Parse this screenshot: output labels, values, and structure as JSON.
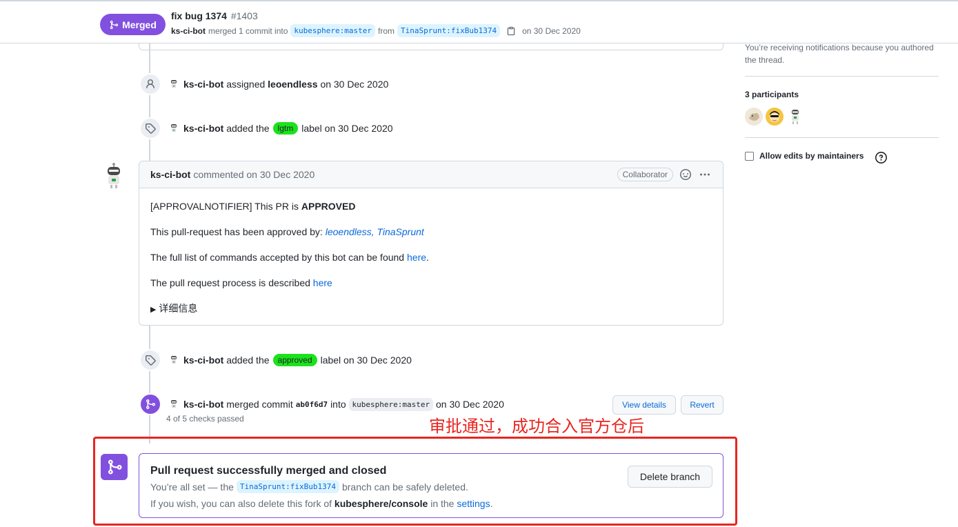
{
  "header": {
    "status": "Merged",
    "title": "fix bug 1374",
    "number": "#1403",
    "author": "ks-ci-bot",
    "merged_text": "merged 1 commit into",
    "base_branch": "kubesphere:master",
    "from_text": "from",
    "head_branch": "TinaSprunt:fixBub1374",
    "date": "on 30 Dec 2020"
  },
  "events": {
    "assigned": {
      "actor": "ks-ci-bot",
      "action": "assigned",
      "target": "leoendless",
      "date": "on 30 Dec 2020"
    },
    "label_lgtm": {
      "actor": "ks-ci-bot",
      "action": "added the",
      "label": "lgtm",
      "label_color": "#1ce21c",
      "suffix": "label on 30 Dec 2020"
    },
    "label_approved": {
      "actor": "ks-ci-bot",
      "action": "added the",
      "label": "approved",
      "label_color": "#1ce21c",
      "suffix": "label on 30 Dec 2020"
    },
    "merged": {
      "actor": "ks-ci-bot",
      "action": "merged commit",
      "sha": "ab0f6d7",
      "into": "into",
      "branch": "kubesphere:master",
      "date": "on 30 Dec 2020",
      "checks": "4 of 5 checks passed",
      "view_details": "View details",
      "revert": "Revert"
    }
  },
  "comment": {
    "author": "ks-ci-bot",
    "when": "commented on 30 Dec 2020",
    "role": "Collaborator",
    "p1_prefix": "[APPROVALNOTIFIER] This PR is",
    "p1_bold": "APPROVED",
    "p2_prefix": "This pull-request has been approved by:",
    "p2_user1": "leoendless",
    "p2_sep": ",",
    "p2_user2": "TinaSprunt",
    "p3_prefix": "The full list of commands accepted by this bot can be found",
    "p3_link": "here",
    "p3_suffix": ".",
    "p4_prefix": "The pull request process is described",
    "p4_link": "here",
    "details_marker": "▶",
    "details": "详细信息"
  },
  "annotation": {
    "text": "审批通过，成功合入官方仓后",
    "color": "#e8251f"
  },
  "merge_box": {
    "title": "Pull request successfully merged and closed",
    "line1_prefix": "You’re all set — the",
    "branch": "TinaSprunt:fixBub1374",
    "line1_suffix": "branch can be safely deleted.",
    "line2_prefix": "If you wish, you can also delete this fork of",
    "repo": "kubesphere/console",
    "line2_mid": "in the",
    "settings_link": "settings",
    "line2_suffix": ".",
    "delete_button": "Delete branch"
  },
  "sidebar": {
    "notice": "You’re receiving notifications because you authored the thread.",
    "participants": "3 participants",
    "allow_edits": "Allow edits by maintainers"
  },
  "colors": {
    "merged_purple": "#8250df",
    "link_blue": "#0969da",
    "label_green": "#1ce21c"
  }
}
